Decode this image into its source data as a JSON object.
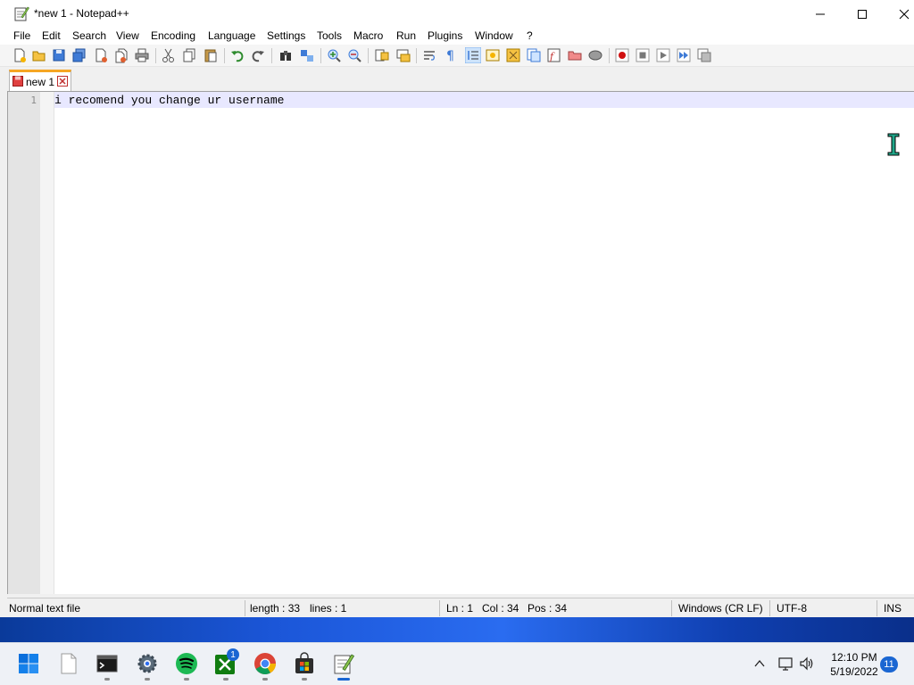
{
  "window": {
    "title": "*new 1 - Notepad++"
  },
  "menu": {
    "items": [
      "File",
      "Edit",
      "Search",
      "View",
      "Encoding",
      "Language",
      "Settings",
      "Tools",
      "Macro",
      "Run",
      "Plugins",
      "Window",
      "?"
    ]
  },
  "tabs": [
    {
      "label": "new 1",
      "modified": true,
      "active": true
    }
  ],
  "editor": {
    "lines": [
      {
        "number": "1",
        "text": "i recomend you change ur username"
      }
    ]
  },
  "statusbar": {
    "file_type": "Normal text file",
    "length": "length : 33",
    "lines": "lines : 1",
    "ln": "Ln : 1",
    "col": "Col : 34",
    "pos": "Pos : 34",
    "eol": "Windows (CR LF)",
    "encoding": "UTF-8",
    "mode": "INS"
  },
  "taskbar": {
    "apps": [
      "start-icon",
      "file-explorer-icon",
      "terminal-icon",
      "settings-icon",
      "spotify-icon",
      "xbox-icon",
      "chrome-icon",
      "store-icon",
      "notepadpp-icon"
    ],
    "xbox_badge": "1",
    "tray": {
      "time": "12:10 PM",
      "date": "5/19/2022",
      "notifications": "11"
    }
  },
  "colors": {
    "current_line": "#e8e8ff",
    "tab_accent": "#f6a623",
    "taskbar_bg": "#eef1f6",
    "accent_blue": "#1a66d2"
  }
}
